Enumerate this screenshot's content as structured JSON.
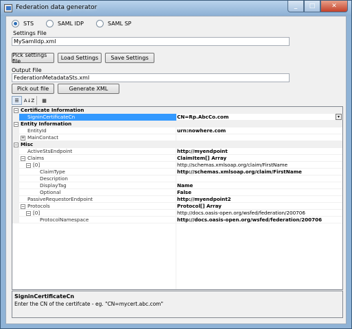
{
  "window": {
    "title": "Federation data generator",
    "buttons": {
      "minimize": "_",
      "maximize": "□",
      "close": "✕"
    }
  },
  "mode": {
    "options": [
      "STS",
      "SAML IDP",
      "SAML SP"
    ],
    "selected": "STS"
  },
  "settings": {
    "label": "Settings File",
    "value": "MySamlIdp.xml",
    "pick_button": "Pick settings file",
    "load_button": "Load Settings",
    "save_button": "Save Settings"
  },
  "output": {
    "label": "Output File",
    "value": "FederationMetadataSts.xml",
    "pick_button": "Pick out file",
    "generate_button": "Generate XML"
  },
  "toolbar": {
    "categorized_icon": "categorized-icon",
    "alphabetical_icon": "alphabetical-icon",
    "alphabetical_glyph": "A↓Z",
    "pages_icon": "property-pages-icon"
  },
  "grid": {
    "rows": [
      {
        "name": "Certificate Information",
        "value": "",
        "kind": "category",
        "expander": "⊟"
      },
      {
        "name": "SigninCertificateCn",
        "value": "CN=Rp.AbcCo.com",
        "kind": "selected"
      },
      {
        "name": "Entity Information",
        "value": "",
        "kind": "category",
        "expander": "⊟"
      },
      {
        "name": "EntityId",
        "value": "urn:nowhere.com",
        "kind": "bold"
      },
      {
        "name": "MainContact",
        "value": "",
        "kind": "plain",
        "expander": "⊞"
      },
      {
        "name": "Misc",
        "value": "",
        "kind": "category",
        "expander": "⊟"
      },
      {
        "name": "ActiveStsEndpoint",
        "value": "http://myendpoint",
        "kind": "bold"
      },
      {
        "name": "Claims",
        "value": "ClaimItem[] Array",
        "kind": "bold",
        "expander": "⊟"
      },
      {
        "name": "[0]",
        "value": "http://schemas.xmlsoap.org/claim/FirstName",
        "kind": "plain",
        "expander": "⊟"
      },
      {
        "name": "ClaimType",
        "value": "http://schemas.xmlsoap.org/claim/FirstName",
        "kind": "bold"
      },
      {
        "name": "Description",
        "value": "",
        "kind": "plain"
      },
      {
        "name": "DisplayTag",
        "value": "Name",
        "kind": "bold"
      },
      {
        "name": "Optional",
        "value": "False",
        "kind": "bold"
      },
      {
        "name": "PassiveRequestorEndpoint",
        "value": "http://myendpoint2",
        "kind": "bold"
      },
      {
        "name": "Protocols",
        "value": "Protocol[] Array",
        "kind": "bold",
        "expander": "⊟"
      },
      {
        "name": "[0]",
        "value": "http://docs.oasis-open.org/wsfed/federation/200706",
        "kind": "plain",
        "expander": "⊟"
      },
      {
        "name": "ProtocolNamespace",
        "value": "http://docs.oasis-open.org/wsfed/federation/200706",
        "kind": "bold"
      }
    ]
  },
  "help": {
    "title": "SigninCertificateCn",
    "description": "Enter the CN of the certifcate - eg. \"CN=mycert.abc.com\""
  }
}
